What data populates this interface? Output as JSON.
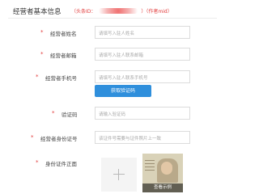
{
  "header": {
    "title": "经营者基本信息",
    "subtitle_prefix": "（头条ID：",
    "subtitle_suffix": "）（作者mid）"
  },
  "fields": [
    {
      "label": "经营者姓名",
      "placeholder": "请填写入驻人姓名"
    },
    {
      "label": "经营者邮箱",
      "placeholder": "请填写入驻人联系邮箱"
    },
    {
      "label": "经营者手机号",
      "placeholder": "请填写入驻人联系手机号"
    },
    {
      "label": "验证码",
      "placeholder": "请输入验证码"
    },
    {
      "label": "经营者身份证号",
      "placeholder": "该证件号需要与证件照片上一致"
    }
  ],
  "verify_button": "获取验证码",
  "id_front": {
    "label": "身份证件正面",
    "sample_caption": "查看示例"
  },
  "colors": {
    "required": "#e23b3b",
    "accent": "#2f8fdc"
  }
}
